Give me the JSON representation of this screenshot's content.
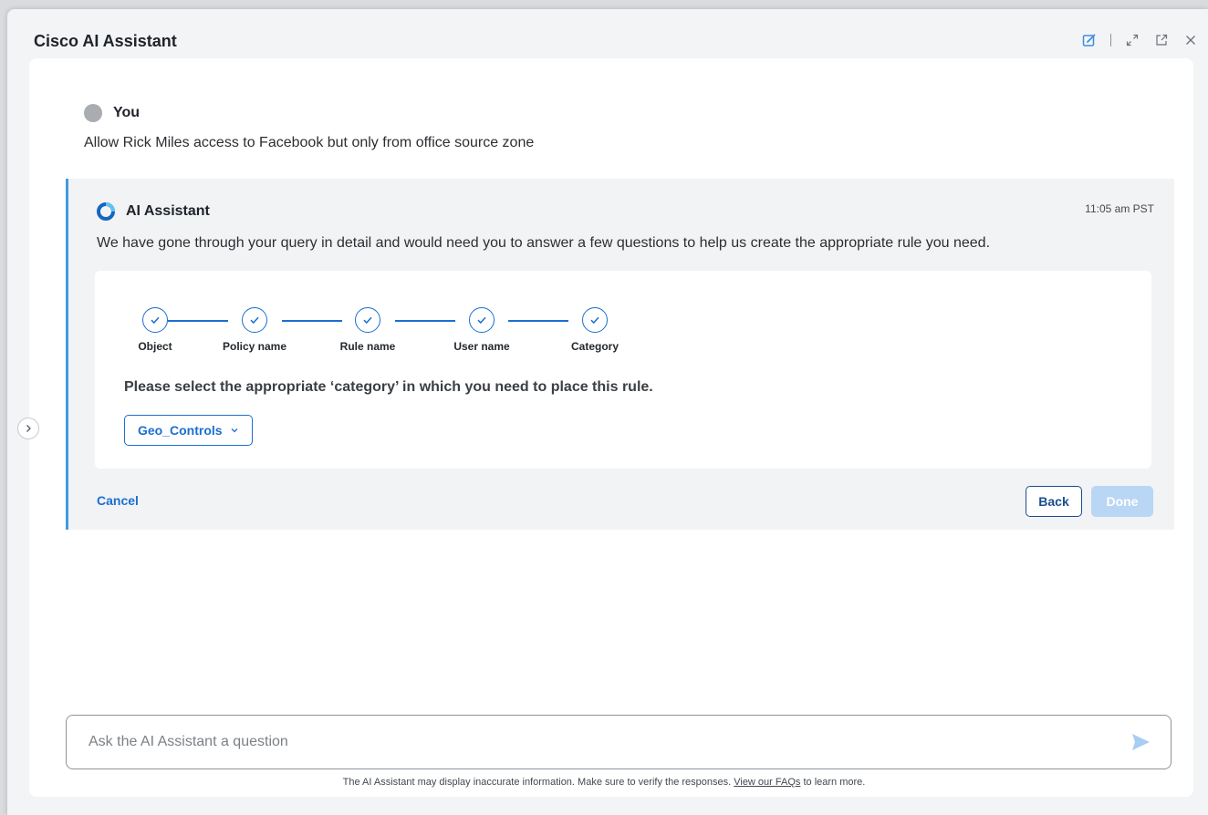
{
  "window": {
    "title": "Cisco AI Assistant",
    "controls": [
      "edit-icon",
      "expand-icon",
      "popout-icon",
      "close-icon"
    ]
  },
  "user": {
    "name": "You",
    "message": "Allow Rick Miles access to Facebook but only from office source zone"
  },
  "assistant": {
    "name": "AI Assistant",
    "time": "11:05 am PST",
    "message": "We have gone through your query in detail and would need you to answer a few questions to help us create the appropriate rule you need.",
    "steps": [
      {
        "label": "Object",
        "done": true
      },
      {
        "label": "Policy name",
        "done": true
      },
      {
        "label": "Rule name",
        "done": true
      },
      {
        "label": "User name",
        "done": true
      },
      {
        "label": "Category",
        "done": true
      }
    ],
    "prompt": "Please select the appropriate ‘category’ in which you need to place this rule.",
    "dropdown_value": "Geo_Controls",
    "cancel_label": "Cancel",
    "back_label": "Back",
    "done_label": "Done"
  },
  "input": {
    "placeholder": "Ask the AI Assistant a question"
  },
  "disclaimer": {
    "before": "The AI Assistant may display inaccurate information. Make sure to verify the responses.",
    "link": "View our FAQs",
    "after": "to learn more."
  },
  "colors": {
    "accent": "#1a6fd0",
    "ai_border": "#3e9ce6",
    "done_disabled": "#b9d6f5"
  }
}
